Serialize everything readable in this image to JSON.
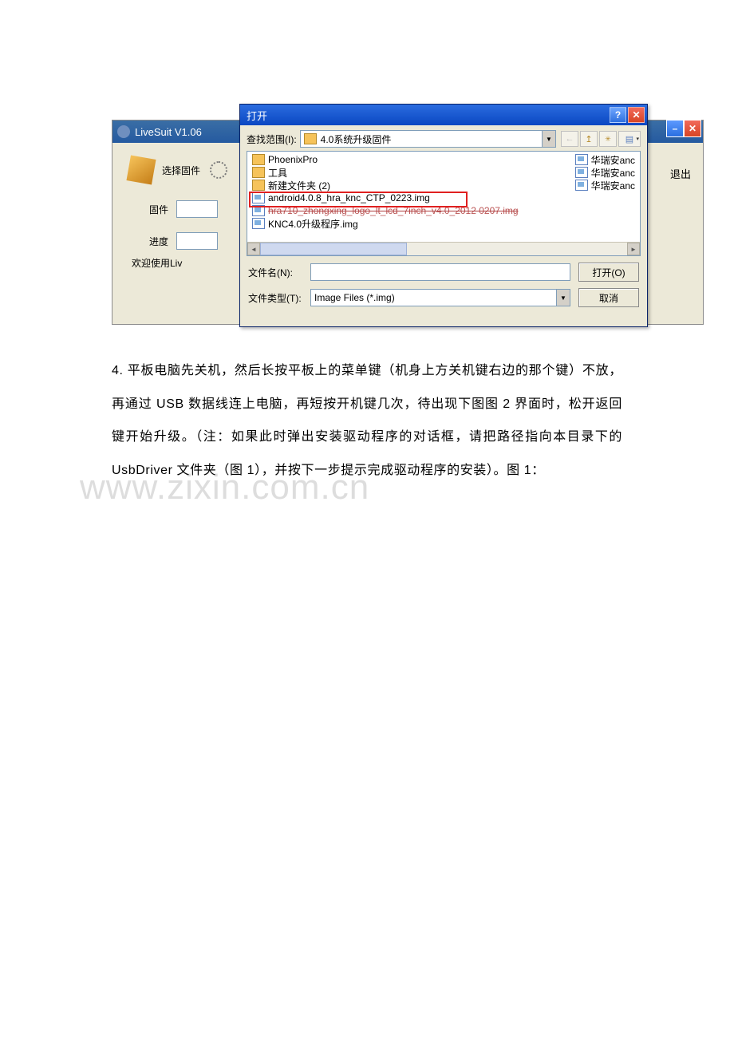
{
  "livesuit": {
    "title": "LiveSuit V1.06",
    "select_firmware": "选择固件",
    "label_firmware": "固件",
    "label_progress": "进度",
    "status": "欢迎使用Liv",
    "exit": "退出"
  },
  "opendlg": {
    "title": "打开",
    "lookin_label": "查找范围(I):",
    "lookin_value": "4.0系统升级固件",
    "left_files": [
      {
        "name": "PhoenixPro",
        "type": "folder"
      },
      {
        "name": "工具",
        "type": "folder"
      },
      {
        "name": "新建文件夹 (2)",
        "type": "folder"
      },
      {
        "name": "android4.0.8_hra_knc_CTP_0223.img",
        "type": "img",
        "red": true
      },
      {
        "name": "hra710_zhongxing_logo_lt_lcd_7inch_v4.0_2012 0207.img",
        "type": "img",
        "strike": true
      },
      {
        "name": "KNC4.0升级程序.img",
        "type": "img"
      }
    ],
    "right_files": [
      {
        "name": "华瑞安anc",
        "type": "img"
      },
      {
        "name": "华瑞安anc",
        "type": "img"
      },
      {
        "name": "华瑞安anc",
        "type": "img"
      }
    ],
    "filename_label": "文件名(N):",
    "filename_value": "",
    "filetype_label": "文件类型(T):",
    "filetype_value": "Image Files (*.img)",
    "open_btn": "打开(O)",
    "cancel_btn": "取消"
  },
  "doc": {
    "paragraph": "4. 平板电脑先关机，然后长按平板上的菜单键（机身上方关机键右边的那个键）不放，再通过 USB 数据线连上电脑，再短按开机键几次，待出现下图图 2 界面时，松开返回键开始升级。（注：如果此时弹出安装驱动程序的对话框，请把路径指向本目录下的 UsbDriver 文件夹（图 1），并按下一步提示完成驱动程序的安装）。图 1：",
    "watermark": "www.zixin.com.cn"
  }
}
